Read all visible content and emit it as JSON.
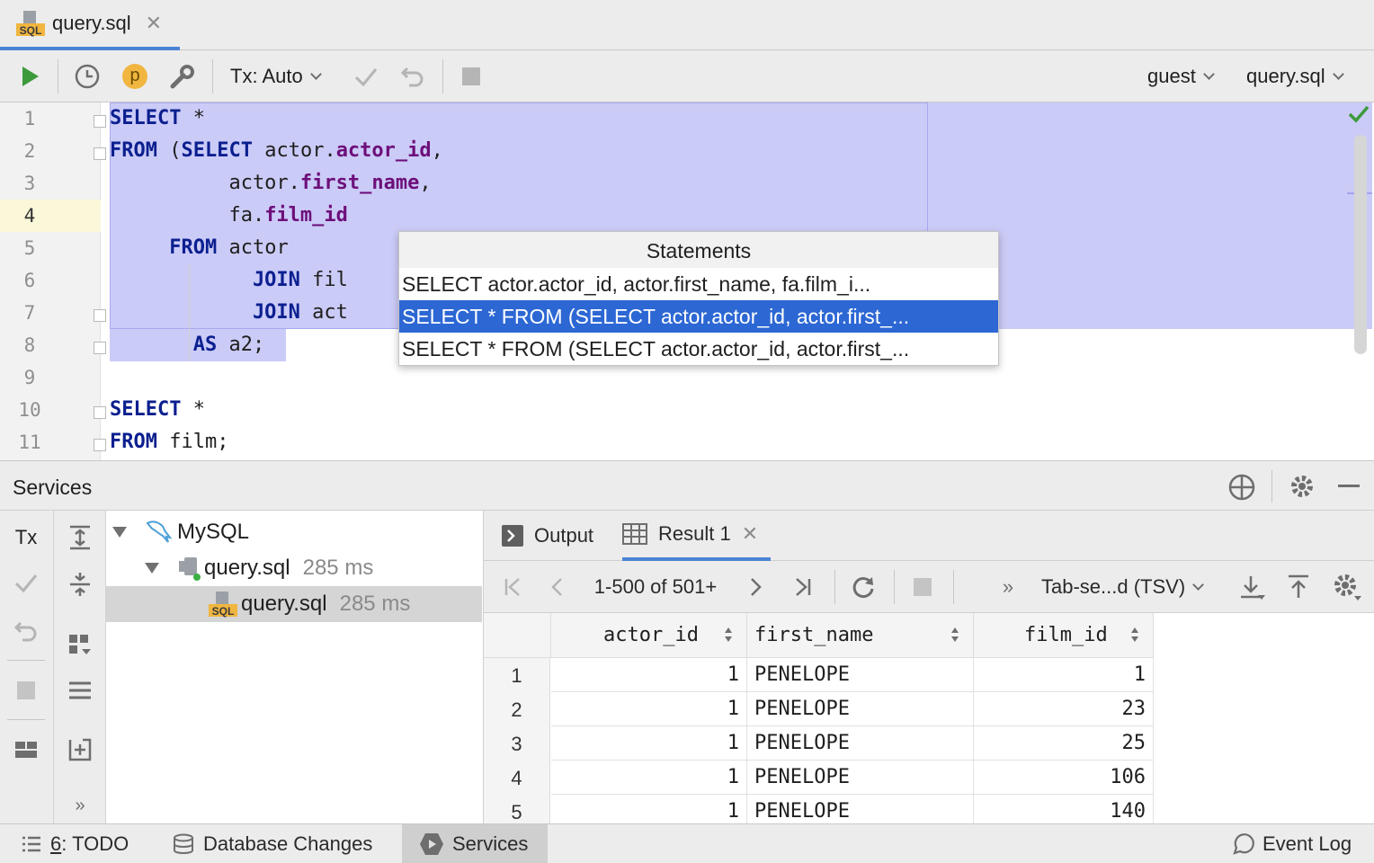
{
  "tab": {
    "label": "query.sql",
    "icon": "sql-file-icon"
  },
  "toolbar": {
    "tx_label": "Tx: Auto",
    "user_label": "guest",
    "console_label": "query.sql",
    "profile_badge": "p"
  },
  "editor": {
    "line_numbers": [
      "1",
      "2",
      "3",
      "4",
      "5",
      "6",
      "7",
      "8",
      "9",
      "10",
      "11"
    ],
    "lines": [
      [
        {
          "t": "SELECT",
          "c": "kw"
        },
        {
          "t": " *",
          "c": ""
        }
      ],
      [
        {
          "t": "FROM",
          "c": "kw"
        },
        {
          "t": " (",
          "c": ""
        },
        {
          "t": "SELECT",
          "c": "kw"
        },
        {
          "t": " actor.",
          "c": ""
        },
        {
          "t": "actor_id",
          "c": "fld"
        },
        {
          "t": ",",
          "c": ""
        }
      ],
      [
        {
          "t": "          actor.",
          "c": ""
        },
        {
          "t": "first_name",
          "c": "fld"
        },
        {
          "t": ",",
          "c": ""
        }
      ],
      [
        {
          "t": "          fa.",
          "c": ""
        },
        {
          "t": "film_id",
          "c": "fld"
        }
      ],
      [
        {
          "t": "     FROM",
          "c": "kw"
        },
        {
          "t": " actor",
          "c": ""
        }
      ],
      [
        {
          "t": "            JOIN",
          "c": "kw"
        },
        {
          "t": " fil",
          "c": ""
        }
      ],
      [
        {
          "t": "            JOIN",
          "c": "kw"
        },
        {
          "t": " act",
          "c": ""
        }
      ],
      [
        {
          "t": "       AS",
          "c": "kw"
        },
        {
          "t": " a2;",
          "c": ""
        }
      ],
      [],
      [
        {
          "t": "SELECT",
          "c": "kw"
        },
        {
          "t": " *",
          "c": ""
        }
      ],
      [
        {
          "t": "FROM",
          "c": "kw"
        },
        {
          "t": " film;",
          "c": ""
        }
      ]
    ]
  },
  "popup": {
    "title": "Statements",
    "items": [
      "SELECT actor.actor_id, actor.first_name, fa.film_i...",
      "SELECT * FROM (SELECT actor.actor_id, actor.first_...",
      "SELECT * FROM (SELECT actor.actor_id, actor.first_..."
    ],
    "selected_index": 1
  },
  "services": {
    "title": "Services",
    "tx_label": "Tx",
    "tree": [
      {
        "label": "MySQL",
        "time": ""
      },
      {
        "label": "query.sql",
        "time": "285 ms"
      },
      {
        "label": "query.sql",
        "time": "285 ms"
      }
    ],
    "tabs": {
      "output": "Output",
      "result": "Result 1"
    },
    "pager": "1-500 of 501+",
    "format": "Tab-se...d (TSV)",
    "more": "»",
    "grid": {
      "columns": [
        "actor_id",
        "first_name",
        "film_id"
      ],
      "rows": [
        {
          "n": "1",
          "actor_id": "1",
          "first_name": "PENELOPE",
          "film_id": "1"
        },
        {
          "n": "2",
          "actor_id": "1",
          "first_name": "PENELOPE",
          "film_id": "23"
        },
        {
          "n": "3",
          "actor_id": "1",
          "first_name": "PENELOPE",
          "film_id": "25"
        },
        {
          "n": "4",
          "actor_id": "1",
          "first_name": "PENELOPE",
          "film_id": "106"
        },
        {
          "n": "5",
          "actor_id": "1",
          "first_name": "PENELOPE",
          "film_id": "140"
        }
      ]
    }
  },
  "statusbar": {
    "todo_prefix": "6",
    "todo_label": ": TODO",
    "db_changes": "Database Changes",
    "services": "Services",
    "event_log": "Event Log"
  },
  "colors": {
    "selection": "#cbcbf8",
    "popup_selected": "#2c67d4",
    "keyword": "#0b1f8f",
    "field": "#6d0f7a",
    "run_green": "#3c9a3c",
    "accent_tab": "#4a83d4"
  }
}
